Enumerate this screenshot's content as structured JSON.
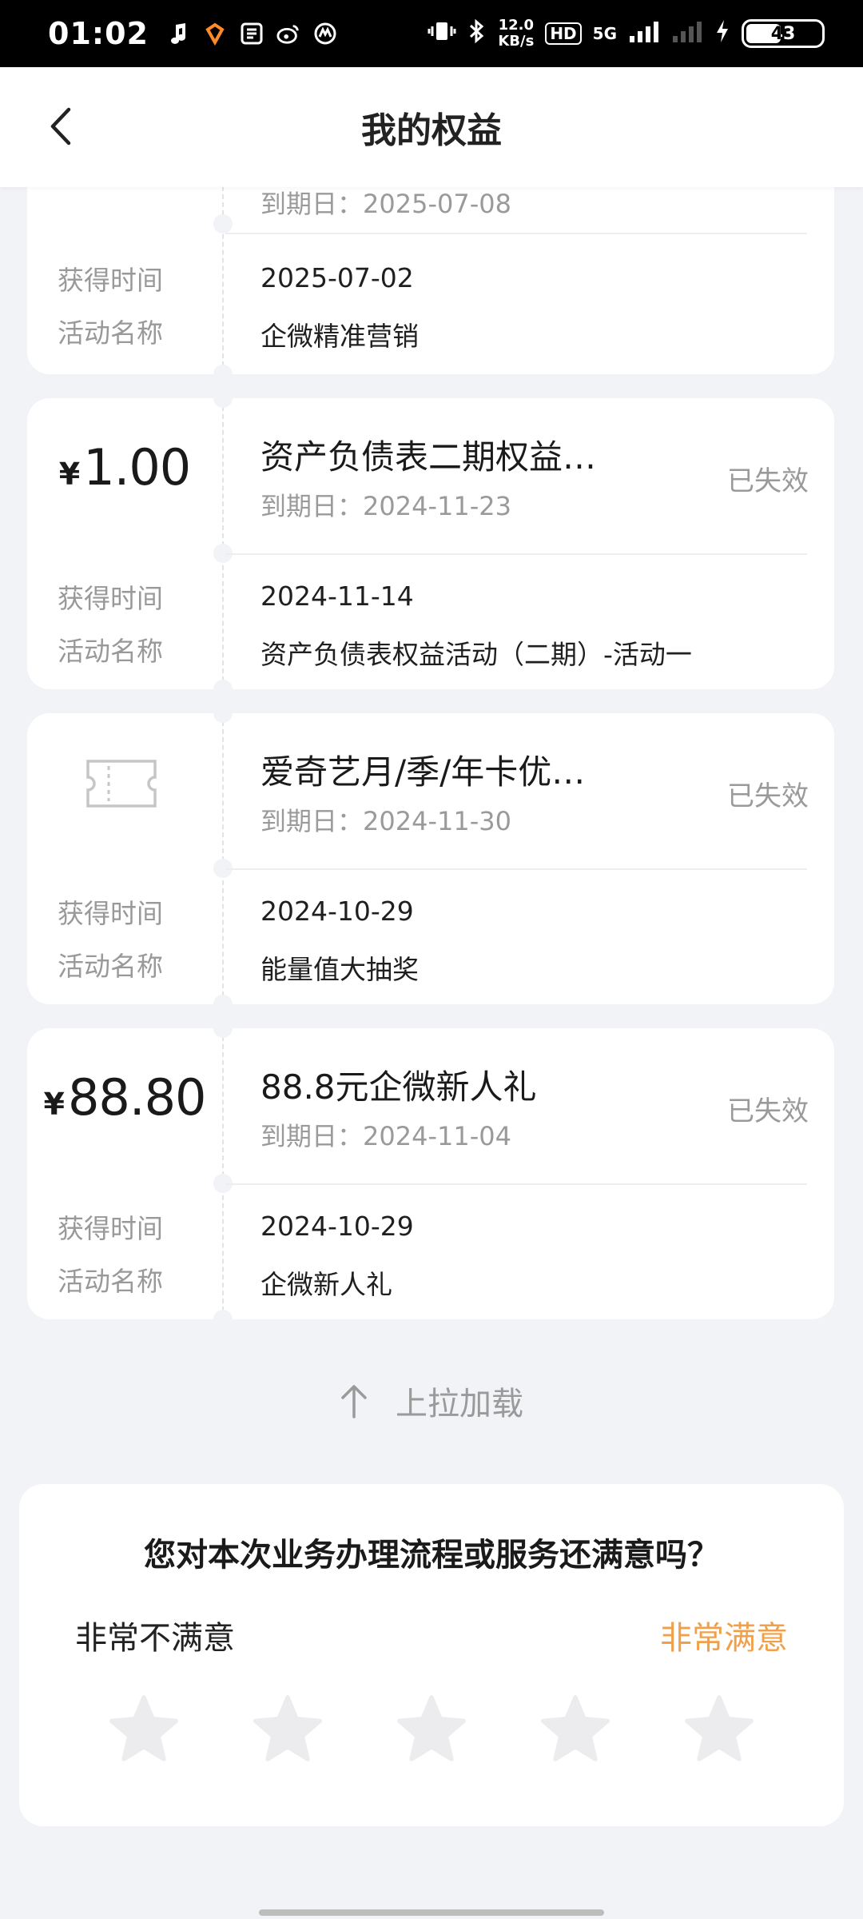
{
  "status_bar": {
    "time": "01:02",
    "net_speed_value": "12.0",
    "net_speed_unit": "KB/s",
    "hd": "HD",
    "signal": "5G",
    "battery": "43"
  },
  "nav": {
    "title": "我的权益"
  },
  "cards": [
    {
      "expire_label": "到期日：",
      "expire_date": "2025-07-08",
      "obtain_label": "获得时间",
      "obtain_date": "2025-07-02",
      "activity_label": "活动名称",
      "activity_name": "企微精准营销"
    },
    {
      "amount_symbol": "¥",
      "amount": "1.00",
      "title": "资产负债表二期权益…",
      "expire_label": "到期日：",
      "expire_date": "2024-11-23",
      "status": "已失效",
      "obtain_label": "获得时间",
      "obtain_date": "2024-11-14",
      "activity_label": "活动名称",
      "activity_name": "资产负债表权益活动（二期）-活动一"
    },
    {
      "icon": "ticket-icon",
      "title": "爱奇艺月/季/年卡优…",
      "expire_label": "到期日：",
      "expire_date": "2024-11-30",
      "status": "已失效",
      "obtain_label": "获得时间",
      "obtain_date": "2024-10-29",
      "activity_label": "活动名称",
      "activity_name": "能量值大抽奖"
    },
    {
      "amount_symbol": "¥",
      "amount": "88.80",
      "title": "88.8元企微新人礼",
      "expire_label": "到期日：",
      "expire_date": "2024-11-04",
      "status": "已失效",
      "obtain_label": "获得时间",
      "obtain_date": "2024-10-29",
      "activity_label": "活动名称",
      "activity_name": "企微新人礼"
    }
  ],
  "pull_load": {
    "label": "上拉加载"
  },
  "survey": {
    "question": "您对本次业务办理流程或服务还满意吗？",
    "low_label": "非常不满意",
    "high_label": "非常满意",
    "rating": 0,
    "max_rating": 5,
    "high_color": "#f0a04a"
  }
}
